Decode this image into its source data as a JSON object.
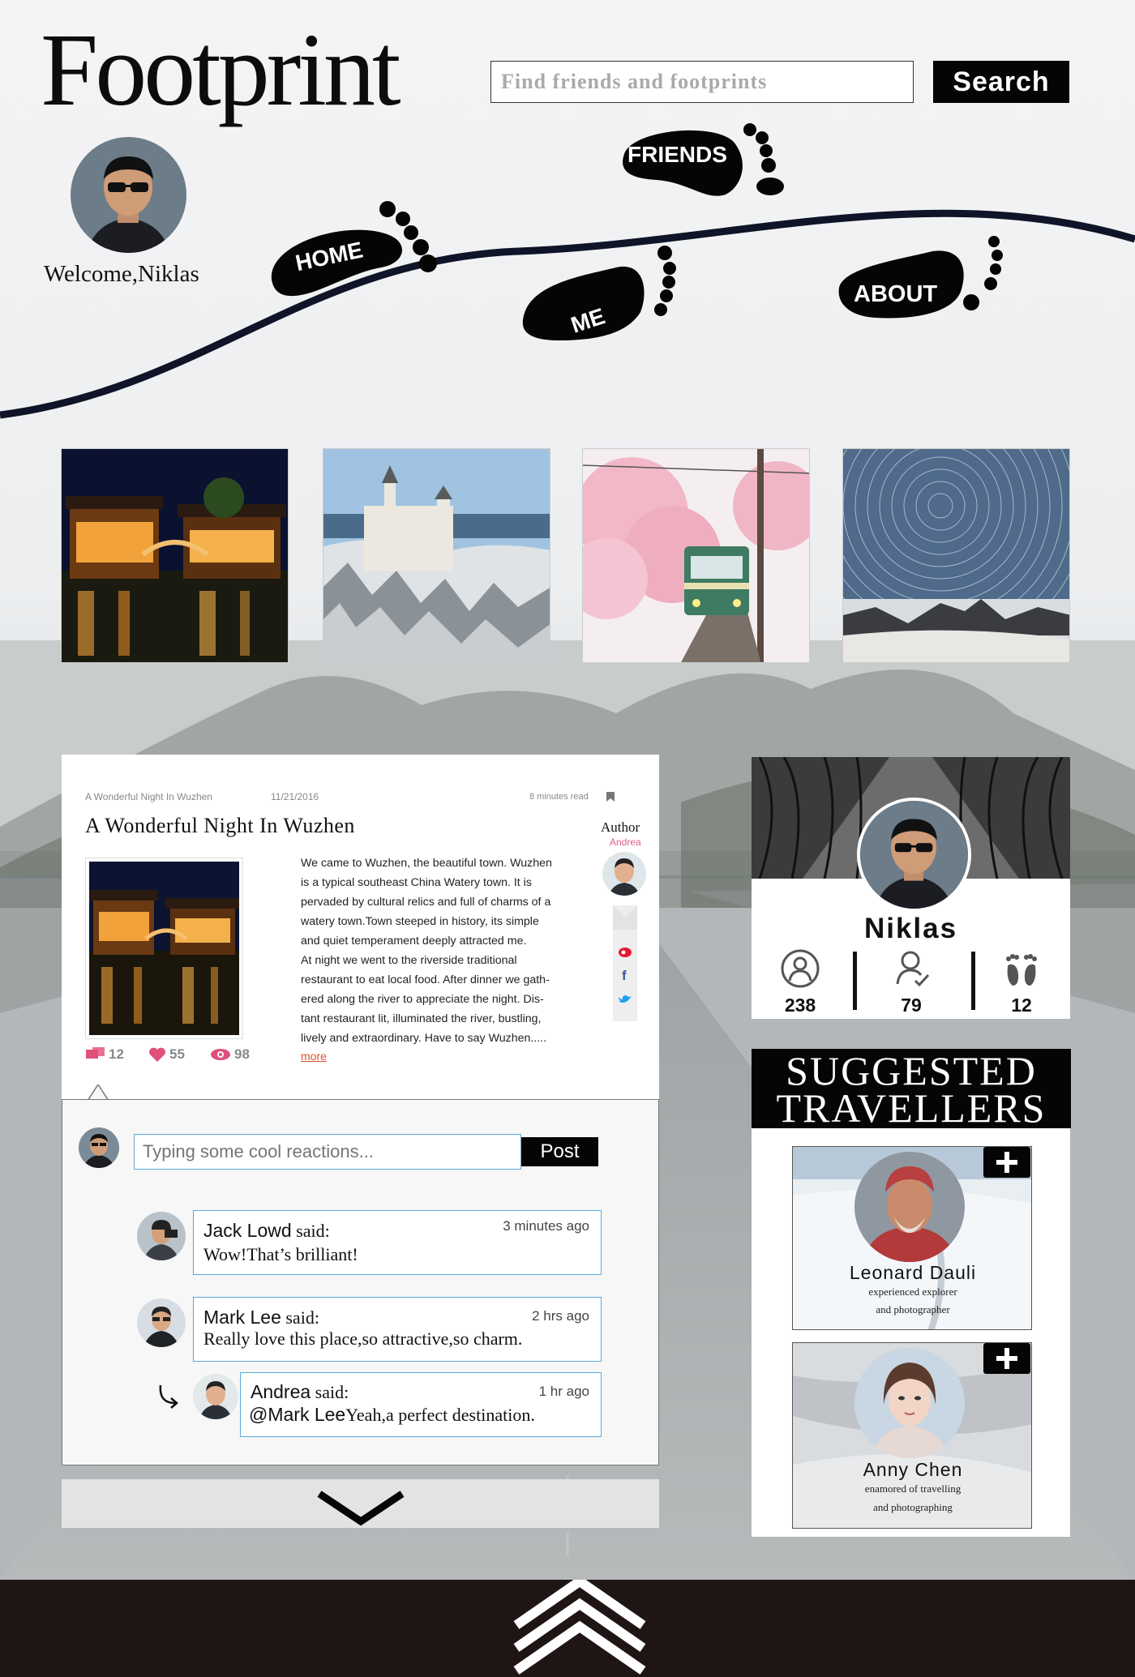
{
  "brand": {
    "logo": "Footprint"
  },
  "search": {
    "placeholder": "Find friends and footprints",
    "button_label": "Search"
  },
  "user": {
    "welcome": "Welcome,Niklas"
  },
  "nav": {
    "home": "HOME",
    "me": "ME",
    "friends": "FRIENDS",
    "about": "ABOUT"
  },
  "article": {
    "breadcrumb": "A Wonderful Night In Wuzhen",
    "date": "11/21/2016",
    "read_time": "8 minutes read",
    "title": "A Wonderful Night In Wuzhen",
    "author_label": "Author",
    "author_name": "Andrea",
    "body_lines": [
      "We came to Wuzhen, the beautiful town. Wuzhen",
      "is a typical southeast China Watery town. It is",
      "pervaded by cultural relics and full of charms of a",
      "watery town.Town steeped in history, its simple",
      "and quiet temperament deeply attracted me.",
      "At night we went to the riverside traditional",
      "restaurant to eat local food. After dinner we gath-",
      "ered along the river to appreciate the night. Dis-",
      "tant restaurant lit, illuminated the river, bustling,",
      "lively and extraordinary. Have to say Wuzhen....."
    ],
    "more": "more",
    "comments_count": "12",
    "likes_count": "55",
    "views_count": "98"
  },
  "comment_form": {
    "placeholder": "Typing some cool reactions...",
    "post_label": "Post"
  },
  "comments": [
    {
      "name": "Jack Lowd",
      "said": " said:",
      "time": "3 minutes ago",
      "text": "Wow!That’s brilliant!"
    },
    {
      "name": "Mark Lee",
      "said": " said:",
      "time": "2 hrs ago",
      "text": "Really love this place,so attractive,so charm."
    }
  ],
  "reply": {
    "name": "Andrea",
    "said": " said:",
    "time": "1 hr ago",
    "mention": "@Mark Lee",
    "text": "Yeah,a perfect destination."
  },
  "profile": {
    "name": "Niklas",
    "followers": "238",
    "following": "79",
    "footprints": "12"
  },
  "suggested": {
    "title_line1": "SUGGESTED",
    "title_line2": "TRAVELLERS",
    "travellers": [
      {
        "name": "Leonard Dauli",
        "desc1": "experienced explorer",
        "desc2": "and photographer"
      },
      {
        "name": "Anny Chen",
        "desc1": "enamored of travelling",
        "desc2": "and photographing"
      }
    ]
  },
  "colors": {
    "accent_blue": "#5aa9d9",
    "more_link": "#d9532a",
    "author_pink": "#e05a8a",
    "footer": "#201515",
    "ink": "#050505"
  },
  "icons": [
    "search-icon",
    "footprint-icon",
    "bookmark-icon",
    "comment-icon",
    "heart-icon",
    "eye-icon",
    "weibo-icon",
    "facebook-icon",
    "twitter-icon",
    "user-icon",
    "user-check-icon",
    "plus-icon",
    "refresh-icon",
    "chevron-down-icon",
    "chevrons-up-icon",
    "reply-arrow-icon"
  ]
}
